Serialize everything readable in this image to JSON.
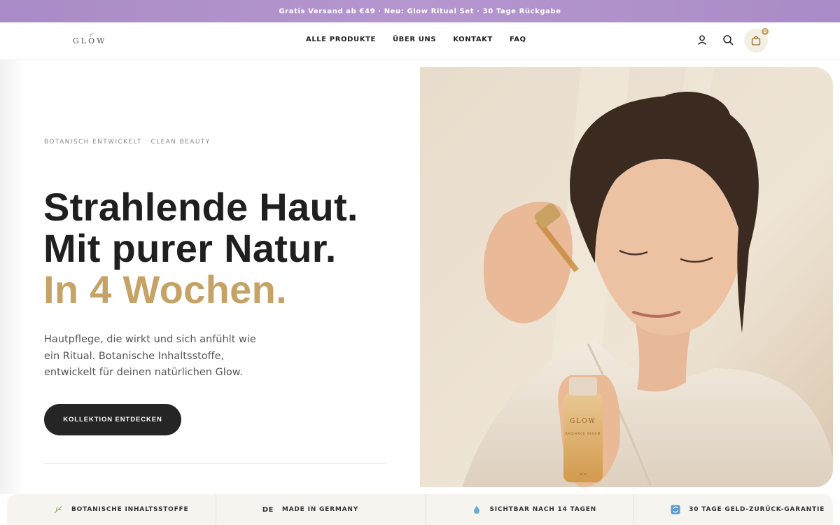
{
  "announcement": "Gratis Versand ab €49 · Neu: Glow Ritual Set · 30 Tage Rückgabe",
  "header": {
    "logo": "GLOW",
    "nav": [
      "ALLE PRODUKTE",
      "ÜBER UNS",
      "KONTAKT",
      "FAQ"
    ],
    "icons": [
      "user-icon",
      "search-icon",
      "cart-icon"
    ],
    "cart_count": "0"
  },
  "hero": {
    "eyebrow": "BOTANISCH ENTWICKELT · CLEAN BEAUTY",
    "headline_line1": "Strahlende Haut.",
    "headline_line2": "Mit purer Natur.",
    "headline_line3": "In 4 Wochen.",
    "lead": "Hautpflege, die wirkt und sich anfühlt wie ein Ritual. Botanische Inhaltsstoffe, entwickelt für deinen natürlichen Glow.",
    "cta": "KOLLEKTION ENTDECKEN",
    "bottle_brand": "GLOW",
    "bottle_name": "RADIANCE SERUM",
    "bottle_volume": "30 ml"
  },
  "trust": [
    {
      "icon": "leaf-icon",
      "label": "BOTANISCHE INHALTSSTOFFE"
    },
    {
      "icon": "de-icon",
      "icon_text": "DE",
      "label": "MADE IN GERMANY"
    },
    {
      "icon": "droplet-icon",
      "label": "SICHTBAR NACH 14 TAGEN"
    },
    {
      "icon": "refresh-icon",
      "label": "30 TAGE GELD-ZURÜCK-GARANTIE"
    }
  ],
  "colors": {
    "announcement_bg": "#ab8dc9",
    "accent_gold": "#c5a265",
    "cta_bg": "#252525",
    "trust_bg": "#f6f4ef"
  }
}
